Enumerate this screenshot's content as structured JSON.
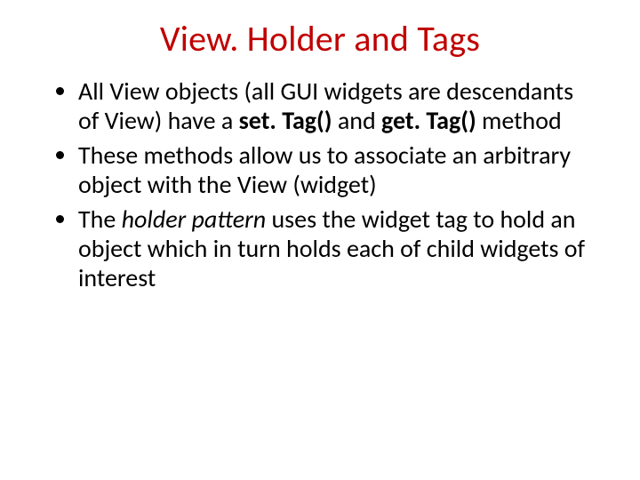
{
  "slide": {
    "title": "View. Holder and Tags",
    "bullets": [
      {
        "pre": "All View objects (all GUI widgets are descendants of View) have a ",
        "bold1": "set. Tag() ",
        "mid": "and ",
        "bold2": "get. Tag() ",
        "post": "method"
      },
      {
        "text": "These methods allow us to associate an arbitrary object with the View (widget)"
      },
      {
        "pre": "The ",
        "ital": "holder pattern ",
        "post": "uses the widget tag to hold an object which in turn holds each of child widgets of interest"
      }
    ]
  }
}
